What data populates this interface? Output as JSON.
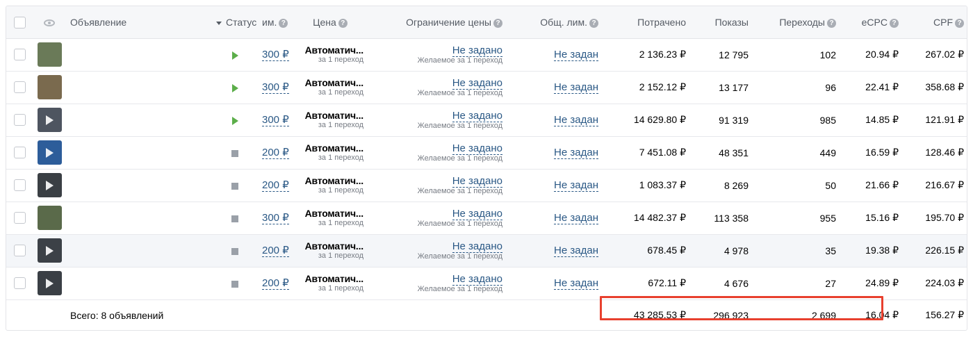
{
  "header": {
    "ad": "Объявление",
    "status": "Статус",
    "impr": "им.",
    "price": "Цена",
    "price_limit": "Ограничение цены",
    "total_limit": "Общ. лим.",
    "spent": "Потрачено",
    "impressions": "Показы",
    "clicks": "Переходы",
    "ecpc": "eCPC",
    "cpf": "CPF",
    "help_glyph": "?"
  },
  "rows": [
    {
      "thumb_color": "#6a7a58",
      "video": false,
      "status": "active",
      "bid": "300 ₽",
      "price": "Автоматич...",
      "price_sub": "за 1 переход",
      "limit": "Не задано",
      "limit_sub": "Желаемое за 1 переход",
      "total_limit": "Не задан",
      "spent": "2 136.23 ₽",
      "impressions": "12 795",
      "clicks": "102",
      "ecpc": "20.94 ₽",
      "cpf": "267.02 ₽"
    },
    {
      "thumb_color": "#7a6a4e",
      "video": false,
      "status": "active",
      "bid": "300 ₽",
      "price": "Автоматич...",
      "price_sub": "за 1 переход",
      "limit": "Не задано",
      "limit_sub": "Желаемое за 1 переход",
      "total_limit": "Не задан",
      "spent": "2 152.12 ₽",
      "impressions": "13 177",
      "clicks": "96",
      "ecpc": "22.41 ₽",
      "cpf": "358.68 ₽"
    },
    {
      "thumb_color": "#4e5560",
      "video": true,
      "status": "active",
      "bid": "300 ₽",
      "price": "Автоматич...",
      "price_sub": "за 1 переход",
      "limit": "Не задано",
      "limit_sub": "Желаемое за 1 переход",
      "total_limit": "Не задан",
      "spent": "14 629.80 ₽",
      "impressions": "91 319",
      "clicks": "985",
      "ecpc": "14.85 ₽",
      "cpf": "121.91 ₽"
    },
    {
      "thumb_color": "#2d5d9a",
      "video": true,
      "status": "stopped",
      "bid": "200 ₽",
      "price": "Автоматич...",
      "price_sub": "за 1 переход",
      "limit": "Не задано",
      "limit_sub": "Желаемое за 1 переход",
      "total_limit": "Не задан",
      "spent": "7 451.08 ₽",
      "impressions": "48 351",
      "clicks": "449",
      "ecpc": "16.59 ₽",
      "cpf": "128.46 ₽"
    },
    {
      "thumb_color": "#3a3f44",
      "video": true,
      "status": "stopped",
      "bid": "200 ₽",
      "price": "Автоматич...",
      "price_sub": "за 1 переход",
      "limit": "Не задано",
      "limit_sub": "Желаемое за 1 переход",
      "total_limit": "Не задан",
      "spent": "1 083.37 ₽",
      "impressions": "8 269",
      "clicks": "50",
      "ecpc": "21.66 ₽",
      "cpf": "216.67 ₽"
    },
    {
      "thumb_color": "#5a6a4a",
      "video": false,
      "status": "stopped",
      "bid": "300 ₽",
      "price": "Автоматич...",
      "price_sub": "за 1 переход",
      "limit": "Не задано",
      "limit_sub": "Желаемое за 1 переход",
      "total_limit": "Не задан",
      "spent": "14 482.37 ₽",
      "impressions": "113 358",
      "clicks": "955",
      "ecpc": "15.16 ₽",
      "cpf": "195.70 ₽"
    },
    {
      "thumb_color": "#3c4147",
      "video": true,
      "status": "stopped",
      "bid": "200 ₽",
      "price": "Автоматич...",
      "price_sub": "за 1 переход",
      "limit": "Не задано",
      "limit_sub": "Желаемое за 1 переход",
      "total_limit": "Не задан",
      "spent": "678.45 ₽",
      "impressions": "4 978",
      "clicks": "35",
      "ecpc": "19.38 ₽",
      "cpf": "226.15 ₽"
    },
    {
      "thumb_color": "#3a3f45",
      "video": true,
      "status": "stopped",
      "bid": "200 ₽",
      "price": "Автоматич...",
      "price_sub": "за 1 переход",
      "limit": "Не задано",
      "limit_sub": "Желаемое за 1 переход",
      "total_limit": "Не задан",
      "spent": "672.11 ₽",
      "impressions": "4 676",
      "clicks": "27",
      "ecpc": "24.89 ₽",
      "cpf": "224.03 ₽"
    }
  ],
  "total": {
    "label": "Всего: 8 объявлений",
    "spent": "43 285.53 ₽",
    "impressions": "296 923",
    "clicks": "2 699",
    "ecpc": "16.04 ₽",
    "cpf": "156.27 ₽"
  },
  "colors": {
    "highlight_box": "#e8402e",
    "status_active": "#5cae4a",
    "status_stopped": "#9aa0a8",
    "link": "#2a5885"
  }
}
